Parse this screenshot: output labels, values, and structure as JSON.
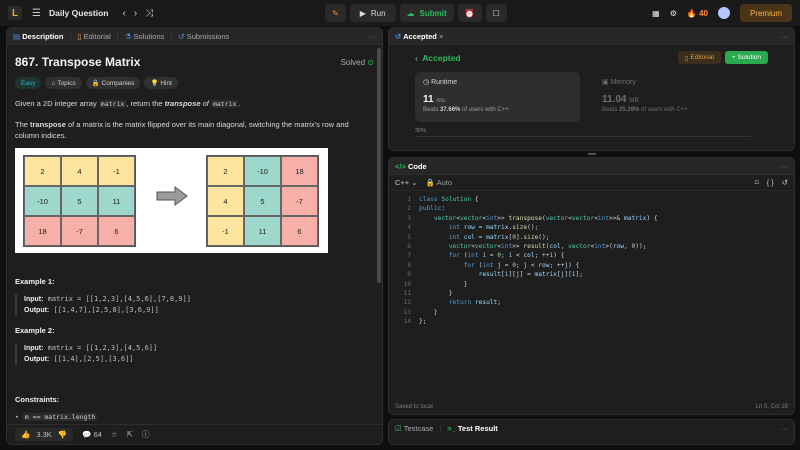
{
  "topbar": {
    "logo": "L",
    "list_icon": "☰",
    "title": "Daily Question",
    "prev_icon": "‹",
    "next_icon": "›",
    "shuffle_icon": "⤨",
    "debug_icon": "✎",
    "run_label": "Run",
    "submit_label": "Submit",
    "timer_icon": "⏰",
    "notes_icon": "☐",
    "grid_icon": "▦",
    "settings_icon": "⚙",
    "streak": "40",
    "premium_label": "Premium"
  },
  "left_tabs": {
    "description": "Description",
    "editorial": "Editorial",
    "solutions": "Solutions",
    "submissions": "Submissions",
    "more": "···"
  },
  "problem": {
    "title": "867. Transpose Matrix",
    "status": "Solved",
    "tags": {
      "difficulty": "Easy",
      "topics": "Topics",
      "companies": "Companies",
      "hint": "Hint"
    },
    "para1_a": "Given a 2D integer array ",
    "para1_code1": "matrix",
    "para1_b": ", return the ",
    "para1_bold": "transpose",
    "para1_c": " of ",
    "para1_code2": "matrix",
    "para1_d": ".",
    "para2_a": "The ",
    "para2_bold": "transpose",
    "para2_b": " of a matrix is the matrix flipped over its main diagonal, switching the matrix's row and column indices.",
    "matrix_before": [
      "2",
      "4",
      "-1",
      "-10",
      "5",
      "11",
      "18",
      "-7",
      "6"
    ],
    "matrix_after": [
      "2",
      "-10",
      "18",
      "4",
      "5",
      "-7",
      "-1",
      "11",
      "6"
    ],
    "example1_title": "Example 1:",
    "example1_input_label": "Input:",
    "example1_input": "matrix = [[1,2,3],[4,5,6],[7,8,9]]",
    "example1_output_label": "Output:",
    "example1_output": "[[1,4,7],[2,5,8],[3,6,9]]",
    "example2_title": "Example 2:",
    "example2_input_label": "Input:",
    "example2_input": "matrix = [[1,2,3],[4,5,6]]",
    "example2_output_label": "Output:",
    "example2_output": "[[1,4],[2,5],[3,6]]",
    "constraints_title": "Constraints:",
    "constraint1": "m == matrix.length"
  },
  "left_bottom": {
    "likes": "3.3K",
    "comments": "64"
  },
  "accepted": {
    "tab_label": "Accepted",
    "title": "Accepted",
    "editorial_btn": "Editorial",
    "solution_btn": "Solution",
    "runtime_label": "Runtime",
    "runtime_value": "11",
    "runtime_unit": "ms",
    "runtime_beats_a": "Beats ",
    "runtime_beats_pct": "37.66%",
    "runtime_beats_b": " of users with C++",
    "memory_label": "Memory",
    "memory_value": "11.04",
    "memory_unit": "MB",
    "memory_beats_a": "Beats ",
    "memory_beats_pct": "25.39%",
    "memory_beats_b": " of users with C++",
    "axis_label": "30%"
  },
  "code": {
    "tab_label": "Code",
    "language": "C++",
    "mode": "Auto",
    "status_left": "Saved to local",
    "status_right": "Ln 5, Col 28",
    "line_numbers": [
      "1",
      "2",
      "3",
      "4",
      "5",
      "6",
      "7",
      "8",
      "9",
      "10",
      "11",
      "12",
      "13",
      "14"
    ]
  },
  "testcase": {
    "testcase_tab": "Testcase",
    "result_tab": "Test Result"
  }
}
